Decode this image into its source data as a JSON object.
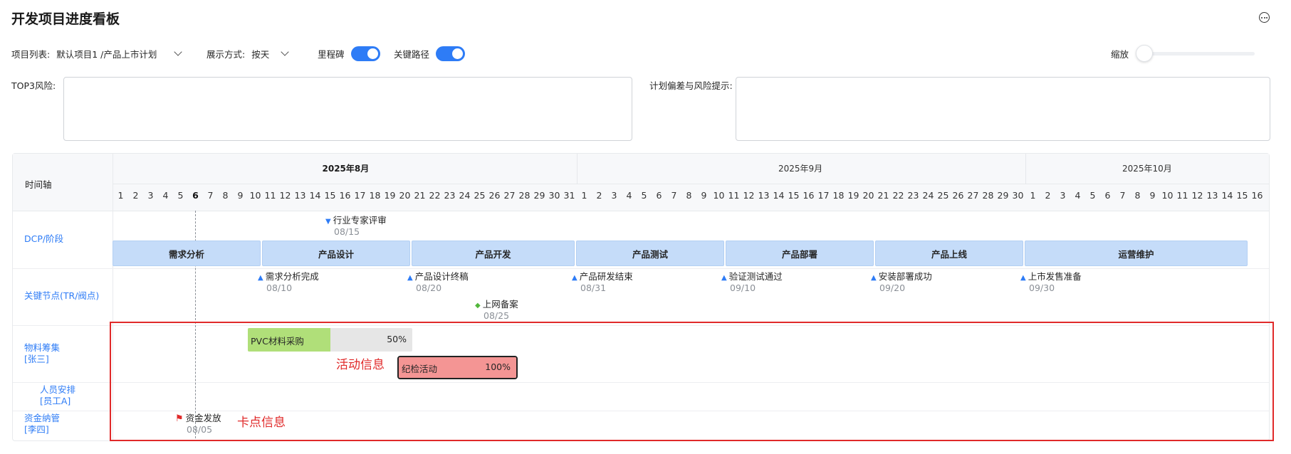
{
  "page_title": "开发项目进度看板",
  "toolbar": {
    "project_label": "项目列表:",
    "project_value": "默认项目1 /产品上市计划",
    "display_label": "展示方式:",
    "display_value": "按天",
    "milestone_label": "里程碑",
    "milestone_on": true,
    "critical_path_label": "关键路径",
    "critical_path_on": true,
    "zoom_label": "缩放",
    "zoom_level": 0
  },
  "risks": {
    "top3_label": "TOP3风险:",
    "top3_value": "",
    "deviation_label": "计划偏差与风险提示:",
    "deviation_value": ""
  },
  "timeline": {
    "axis_label": "时间轴",
    "months": [
      {
        "label": "2025年8月",
        "start_day": 1,
        "days": 31,
        "current": true
      },
      {
        "label": "2025年9月",
        "start_day": 1,
        "days": 30,
        "current": false
      },
      {
        "label": "2025年10月",
        "start_day": 1,
        "days": 16,
        "current": false
      }
    ],
    "today": "2025-08-06"
  },
  "rows": {
    "dcp": "DCP/阶段",
    "key_nodes": "关键节点(TR/阀点)",
    "materials": "物料筹集",
    "materials_owner": "[张三]",
    "staffing": "人员安排",
    "staffing_owner": "[员工A]",
    "funding": "资金纳管",
    "funding_owner": "[李四]"
  },
  "dcp_milestone": {
    "label": "行业专家评审",
    "date": "08/15",
    "icon": "triangle-down-icon"
  },
  "phases": [
    {
      "label": "需求分析",
      "start": "2025-08-01",
      "end": "2025-08-10"
    },
    {
      "label": "产品设计",
      "start": "2025-08-11",
      "end": "2025-08-20"
    },
    {
      "label": "产品开发",
      "start": "2025-08-21",
      "end": "2025-08-31"
    },
    {
      "label": "产品测试",
      "start": "2025-09-01",
      "end": "2025-09-10"
    },
    {
      "label": "产品部署",
      "start": "2025-09-11",
      "end": "2025-09-20"
    },
    {
      "label": "产品上线",
      "start": "2025-09-21",
      "end": "2025-09-30"
    },
    {
      "label": "运营维护",
      "start": "2025-10-01",
      "end": "2025-10-15"
    }
  ],
  "key_nodes": [
    {
      "label": "需求分析完成",
      "date": "08/10"
    },
    {
      "label": "产品设计终稿",
      "date": "08/20"
    },
    {
      "label": "产品研发结束",
      "date": "08/31"
    },
    {
      "label": "验证测试通过",
      "date": "09/10"
    },
    {
      "label": "安装部署成功",
      "date": "09/20"
    },
    {
      "label": "上市发售准备",
      "date": "09/30"
    }
  ],
  "extra_node": {
    "label": "上网备案",
    "date": "08/25",
    "color": "#52b73b"
  },
  "activities": [
    {
      "label": "PVC材料采购",
      "progress": "50%",
      "start": "2025-08-10",
      "end": "2025-08-20",
      "color": "#b0df79"
    },
    {
      "label": "纪检活动",
      "progress": "100%",
      "start": "2025-08-20",
      "end": "2025-08-27",
      "color": "#f49594"
    }
  ],
  "checkpoint": {
    "label": "资金发放",
    "date": "08/05",
    "color": "#e02a2a"
  },
  "annotations": {
    "activity_info": "活动信息",
    "checkpoint_info": "卡点信息"
  },
  "colors": {
    "accent": "#2e7cf6",
    "phase_fill": "#c5dcf9",
    "highlight": "#e02a2a"
  }
}
